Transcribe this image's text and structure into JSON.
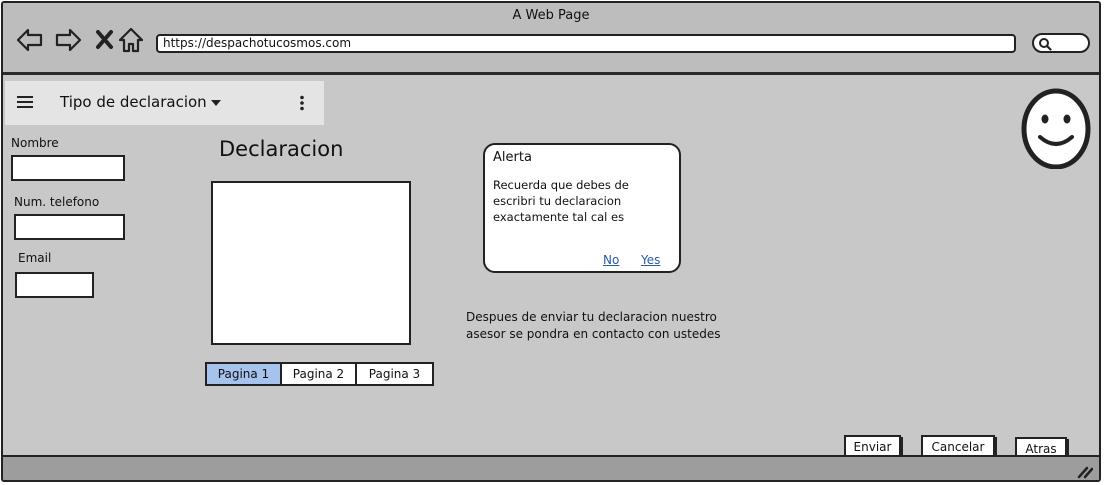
{
  "browser": {
    "window_title": "A Web Page",
    "url": "https://despachotucosmos.com",
    "icons": [
      "back-arrow-icon",
      "forward-arrow-icon",
      "close-icon",
      "home-icon",
      "search-icon"
    ]
  },
  "toolbar": {
    "title": "Tipo de declaracion",
    "icons": [
      "hamburger-menu-icon",
      "caret-down-icon",
      "kebab-menu-icon"
    ]
  },
  "form": {
    "name_label": "Nombre",
    "name_value": "",
    "phone_label": "Num. telefono",
    "phone_value": "",
    "email_label": "Email",
    "email_value": ""
  },
  "declaration": {
    "heading": "Declaracion",
    "text_value": ""
  },
  "pagination": {
    "pages": [
      "Pagina 1",
      "Pagina 2",
      "Pagina 3"
    ],
    "selected": "Pagina 1",
    "active_color": "#a5c3ec"
  },
  "alert": {
    "title": "Alerta",
    "message": "Recuerda que debes de escribri tu declaracion exactamente tal cal es",
    "no_label": "No",
    "yes_label": "Yes",
    "link_color": "#2b5aa8"
  },
  "info_text": "Despues de enviar tu declaracion nuestro asesor se pondra en contacto con ustedes",
  "actions": {
    "send_label": "Enviar",
    "cancel_label": "Cancelar",
    "back_label": "Atras"
  },
  "avatar_icon": "smiley-face-icon"
}
